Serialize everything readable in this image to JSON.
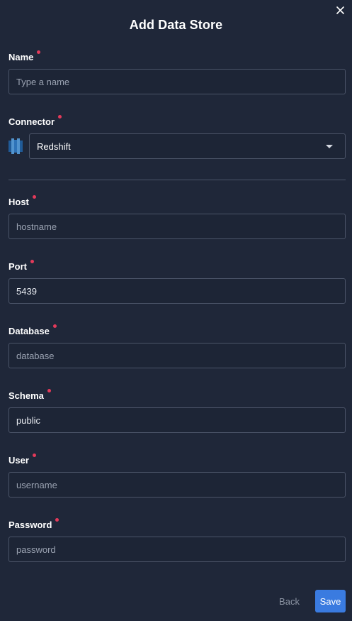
{
  "dialog": {
    "title": "Add Data Store"
  },
  "fields": {
    "name": {
      "label": "Name",
      "value": "",
      "placeholder": "Type a name"
    },
    "connector": {
      "label": "Connector",
      "value": "Redshift",
      "icon": "redshift-icon"
    },
    "host": {
      "label": "Host",
      "value": "",
      "placeholder": "hostname"
    },
    "port": {
      "label": "Port",
      "value": "5439",
      "placeholder": ""
    },
    "database": {
      "label": "Database",
      "value": "",
      "placeholder": "database"
    },
    "schema": {
      "label": "Schema",
      "value": "public",
      "placeholder": ""
    },
    "user": {
      "label": "User",
      "value": "",
      "placeholder": "username"
    },
    "password": {
      "label": "Password",
      "value": "",
      "placeholder": "password"
    }
  },
  "footer": {
    "back_label": "Back",
    "save_label": "Save"
  },
  "colors": {
    "background": "#1f2739",
    "input_border": "#4b5468",
    "required_dot": "#e33a5a",
    "primary_button": "#3a7be0"
  }
}
